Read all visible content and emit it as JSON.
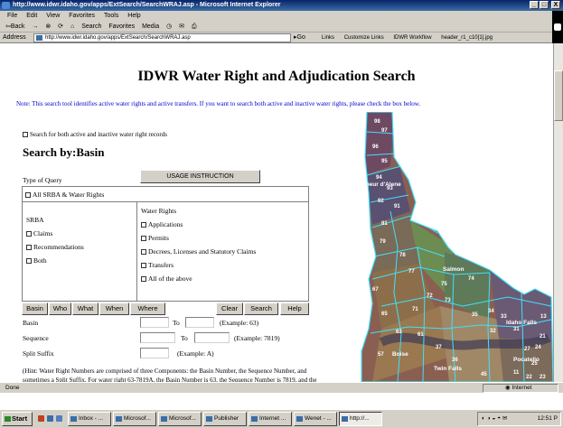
{
  "window": {
    "title": "http://www.idwr.idaho.gov/apps/ExtSearch/SearchWRAJ.asp - Microsoft Internet Explorer",
    "controls": [
      "_",
      "□",
      "X"
    ]
  },
  "menubar": [
    "File",
    "Edit",
    "View",
    "Favorites",
    "Tools",
    "Help"
  ],
  "toolbar": {
    "back": "⇦Back",
    "forward": "→",
    "search": "Search",
    "favorites": "Favorites",
    "media": "Media"
  },
  "addressbar": {
    "label": "Address",
    "url": "http://www.idwr.idaho.gov/apps/ExtSearch/SearchWRAJ.asp",
    "go": "Go",
    "links_label": "Links",
    "links": [
      "Customize Links",
      "IDWR Workflow",
      "header_r1_c10[1].jpg"
    ]
  },
  "page": {
    "heading": "IDWR Water Right and Adjudication Search",
    "note": "Note: This search tool identifies active water rights and active transfers. If you want to search both active and inactive water rights, please check the box below.",
    "include_inactive_label": "Search for both active and inactive water right records",
    "search_by_prefix": "Search by:",
    "search_by_value": "Basin",
    "type_of_query_label": "Type of Query",
    "usage_button": "USAGE INSTRUCTION",
    "all_label": "All SRBA & Water Rights",
    "srba": {
      "heading": "SRBA",
      "options": [
        "Claims",
        "Recommendations",
        "Both"
      ]
    },
    "water_rights": {
      "heading": "Water Rights",
      "options": [
        "Applications",
        "Permits",
        "Decrees, Licenses and Statutory Claims",
        "Transfers",
        "All of the above"
      ]
    },
    "tabs": [
      "Basin",
      "Who",
      "What",
      "When",
      "Where"
    ],
    "actions": [
      "Clear",
      "Search",
      "Help"
    ],
    "fields": {
      "basin": {
        "label": "Basin",
        "to": "To",
        "example": "(Example: 63)"
      },
      "sequence": {
        "label": "Sequence",
        "to": "To",
        "example": "(Example: 7819)"
      },
      "split": {
        "label": "Split Suffix",
        "example": "(Example: A)"
      }
    },
    "hint": "(Hint: Water Right Numbers are comprised of three Components: the Basin Number, the Sequence Number, and sometimes a Split Suffix. For water right 63-7819A, the Basin Number is 63, the Sequence Number is 7819, and the Split Suffix is A. Not all water right numbers have Split Suffixes.)"
  },
  "map": {
    "labels": [
      "Coeur d'Alene",
      "Salmon",
      "Boise",
      "Idaho Falls",
      "Twin Falls",
      "Pocatello"
    ],
    "basin_numbers": [
      "91",
      "92",
      "93",
      "94",
      "95",
      "96",
      "97",
      "98",
      "81",
      "79",
      "78",
      "77",
      "75",
      "74",
      "73",
      "72",
      "71",
      "67",
      "65",
      "63",
      "61",
      "57",
      "37",
      "36",
      "35",
      "34",
      "33",
      "32",
      "31",
      "27",
      "25",
      "24",
      "23",
      "22",
      "21",
      "13",
      "11",
      "45"
    ],
    "colors": {
      "terrain": "#8a5f52",
      "dark": "#3e3a56",
      "green": "#6c8c52",
      "boundary": "#40e0ff",
      "label": "#ffffff"
    }
  },
  "statusbar": {
    "text": "Done",
    "zone": "Internet"
  },
  "taskbar": {
    "start": "Start",
    "tasks": [
      "Inbox - ...",
      "Microsof...",
      "Microsof...",
      "Publisher",
      "Internet ...",
      "Wenet - ...",
      "http://..."
    ],
    "clock": "12:51 P"
  }
}
